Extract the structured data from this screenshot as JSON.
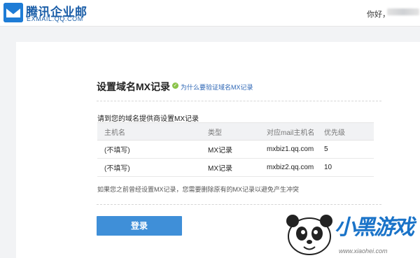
{
  "header": {
    "brand_name": "腾讯企业邮",
    "brand_domain": "EXMAIL.QQ.COM",
    "greeting": "你好，"
  },
  "page": {
    "title": "设置域名MX记录",
    "help_link": "为什么要验证域名MX记录",
    "instruction": "请到您的域名提供商设置MX记录",
    "note": "如果您之前曾经设置MX记录，您需要删除原有的MX记录以避免产生冲突",
    "login_button": "登录"
  },
  "table": {
    "headers": [
      "主机名",
      "类型",
      "对应mail主机名",
      "优先级"
    ],
    "rows": [
      [
        "(不填写)",
        "MX记录",
        "mxbiz1.qq.com",
        "5"
      ],
      [
        "(不填写)",
        "MX记录",
        "mxbiz2.qq.com",
        "10"
      ]
    ]
  },
  "watermark": {
    "logo_text": "小黑游戏",
    "url": "www.xiaohei.com"
  },
  "colors": {
    "brand": "#1b5ea8",
    "button": "#3f8fd8",
    "link": "#2a64b4",
    "help_icon": "#8bc34a"
  },
  "icons": {
    "logo": "tencent-exmail-logo-icon",
    "help": "check-circle-icon",
    "mascot": "panda-mascot-icon"
  }
}
